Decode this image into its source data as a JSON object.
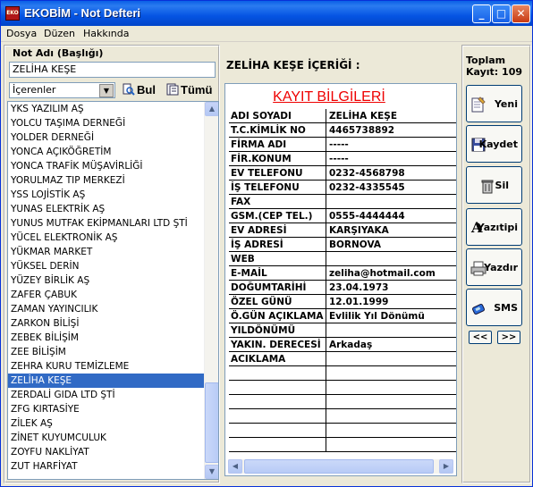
{
  "window": {
    "title": "EKOBİM - Not Defteri",
    "icon_text": "EKO"
  },
  "menu": [
    "Dosya",
    "Düzen",
    "Hakkında"
  ],
  "left": {
    "title": "Not Adı (Başlığı)",
    "name_value": "ZELİHA KEŞE",
    "filter_value": "İçerenler",
    "find_label": "Bul",
    "all_label": "Tümü",
    "items": [
      "YKS YAZILIM AŞ",
      "YOLCU TAŞIMA DERNEĞİ",
      "YOLDER DERNEĞİ",
      "YONCA AÇIKÖĞRETİM",
      "YONCA TRAFİK MÜŞAVİRLİĞİ",
      "YORULMAZ TIP MERKEZİ",
      "YSS LOJİSTİK AŞ",
      "YUNAS ELEKTRİK AŞ",
      "YUNUS MUTFAK EKİPMANLARI LTD ŞTİ",
      "YÜCEL ELEKTRONİK AŞ",
      "YÜKMAR MARKET",
      "YÜKSEL DERİN",
      "YÜZEY BİRLİK AŞ",
      "ZAFER ÇABUK",
      "ZAMAN YAYINCILIK",
      "ZARKON BİLİŞİ",
      "ZEBEK BİLİŞİM",
      "ZEE BİLİŞİM",
      "ZEHRA KURU TEMİZLEME",
      "ZELİHA KEŞE",
      "ZERDALİ GIDA LTD ŞTİ",
      "ZFG KIRTASİYE",
      "ZİLEK AŞ",
      "ZİNET KUYUMCULUK",
      "ZOYFU NAKLİYAT",
      "ZUT HARFİYAT"
    ],
    "selected": "ZELİHA KEŞE"
  },
  "middle": {
    "title": "ZELİHA KEŞE  İÇERİĞİ :",
    "heading": "KAYIT BİLGİLERİ",
    "rows": [
      {
        "label": "ADI SOYADI",
        "value": "ZELİHA KEŞE"
      },
      {
        "label": "T.C.KİMLİK NO",
        "value": "4465738892"
      },
      {
        "label": "FİRMA ADI",
        "value": "-----"
      },
      {
        "label": "FİR.KONUM",
        "value": "-----"
      },
      {
        "label": "EV TELEFONU",
        "value": "0232-4568798"
      },
      {
        "label": "İŞ TELEFONU",
        "value": "0232-4335545"
      },
      {
        "label": "FAX",
        "value": ""
      },
      {
        "label": "GSM.(CEP TEL.)",
        "value": "0555-4444444"
      },
      {
        "label": "EV ADRESİ",
        "value": "KARŞIYAKA"
      },
      {
        "label": "İŞ ADRESİ",
        "value": "BORNOVA"
      },
      {
        "label": "WEB",
        "value": ""
      },
      {
        "label": "E-MAİL",
        "value": "zeliha@hotmail.com"
      },
      {
        "label": "DOĞUMTARİHİ",
        "value": "23.04.1973"
      },
      {
        "label": "ÖZEL GÜNÜ",
        "value": "12.01.1999"
      },
      {
        "label": "Ö.GÜN AÇIKLAMA",
        "value": "Evlilik Yıl Dönümü"
      },
      {
        "label": "YILDÖNÜMÜ",
        "value": ""
      },
      {
        "label": "YAKIN. DERECESİ",
        "value": "Arkadaş"
      },
      {
        "label": "ACIKLAMA",
        "value": ""
      },
      {
        "label": "",
        "value": ""
      },
      {
        "label": "",
        "value": ""
      },
      {
        "label": "",
        "value": ""
      },
      {
        "label": "",
        "value": ""
      },
      {
        "label": "",
        "value": ""
      },
      {
        "label": "",
        "value": ""
      }
    ]
  },
  "right": {
    "total_label": "Toplam",
    "total_count_label": "Kayıt: 109",
    "buttons": {
      "new": "Yeni",
      "save": "Kaydet",
      "delete": "Sil",
      "font": "Yazıtipi",
      "print": "Yazdır",
      "sms": "SMS"
    },
    "prev": "<<",
    "next": ">>"
  }
}
